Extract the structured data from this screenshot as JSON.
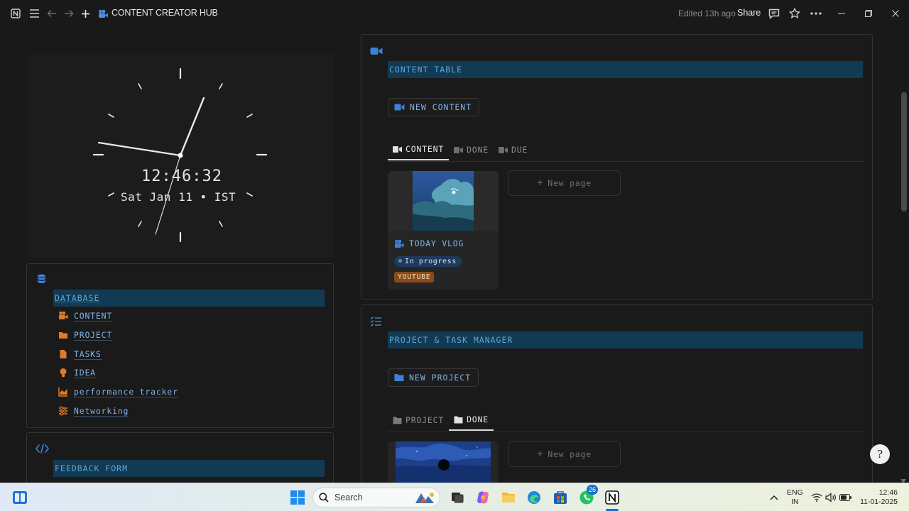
{
  "topbar": {
    "title": "CONTENT CREATOR HUB",
    "edited": "Edited 13h ago",
    "share": "Share"
  },
  "clock": {
    "time": "12:46:32",
    "date": "Sat Jan 11 • IST"
  },
  "database": {
    "heading": "DATABASE",
    "items": [
      {
        "label": "CONTENT",
        "icon": "film-camera-icon"
      },
      {
        "label": "PROJECT",
        "icon": "folder-icon"
      },
      {
        "label": "TASKS",
        "icon": "document-icon"
      },
      {
        "label": "IDEA",
        "icon": "lightbulb-icon"
      },
      {
        "label": "performance tracker",
        "icon": "chart-icon"
      },
      {
        "label": "Networking",
        "icon": "sliders-icon"
      }
    ]
  },
  "feedback": {
    "heading": "FEEDBACK FORM"
  },
  "content_section": {
    "heading": "CONTENT TABLE",
    "new_button": "NEW CONTENT",
    "tabs": [
      "CONTENT",
      "DONE",
      "DUE"
    ],
    "active_tab": "CONTENT",
    "card": {
      "title": "TODAY VLOG",
      "status": "In progress",
      "platform": "YOUTUBE"
    },
    "new_page": "New page"
  },
  "project_section": {
    "heading": "PROJECT & TASK MANAGER",
    "new_button": "NEW PROJECT",
    "tabs": [
      "PROJECT",
      "DONE"
    ],
    "active_tab": "DONE",
    "new_page": "New page"
  },
  "taskbar": {
    "search_placeholder": "Search",
    "whatsapp_badge": "26",
    "lang_top": "ENG",
    "lang_bottom": "IN",
    "time": "12:46",
    "date": "11-01-2025"
  },
  "colors": {
    "accent_blue": "#3b82d6",
    "highlight_bar": "#123a52",
    "icon_orange": "#e07b2a",
    "youtube_tag": "#8a4b17",
    "status_tag": "#1e3a5c"
  }
}
